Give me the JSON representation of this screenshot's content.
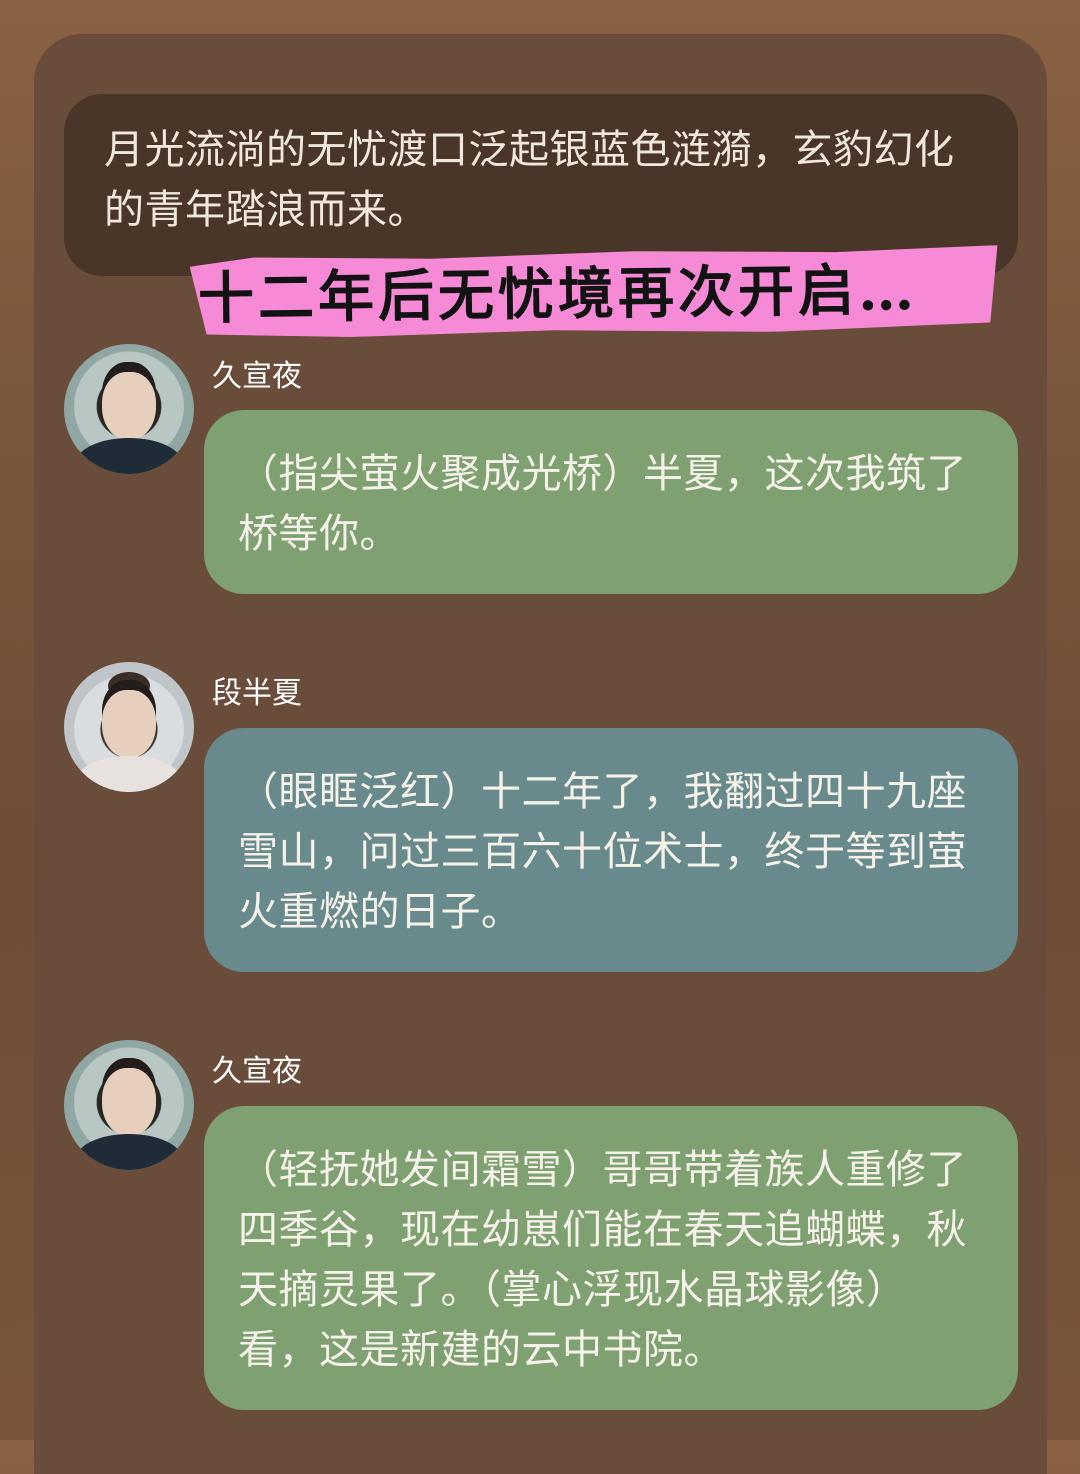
{
  "narration": {
    "text": "月光流淌的无忧渡口泛起银蓝色涟漪，玄豹幻化的青年踏浪而来。"
  },
  "banner": {
    "text": "十二年后无忧境再次开启…"
  },
  "messages": [
    {
      "speaker": "久宣夜",
      "text": "（指尖萤火聚成光桥）半夏，这次我筑了桥等你。",
      "bubble_color": "#7fa071"
    },
    {
      "speaker": "段半夏",
      "text": "（眼眶泛红）十二年了，我翻过四十九座雪山，问过三百六十位术士，终于等到萤火重燃的日子。",
      "bubble_color": "#688a8c"
    },
    {
      "speaker": "久宣夜",
      "text": "（轻抚她发间霜雪）哥哥带着族人重修了四季谷，现在幼崽们能在春天追蝴蝶，秋天摘灵果了。（掌心浮现水晶球影像）看，这是新建的云中书院。",
      "bubble_color": "#7fa071"
    }
  ]
}
